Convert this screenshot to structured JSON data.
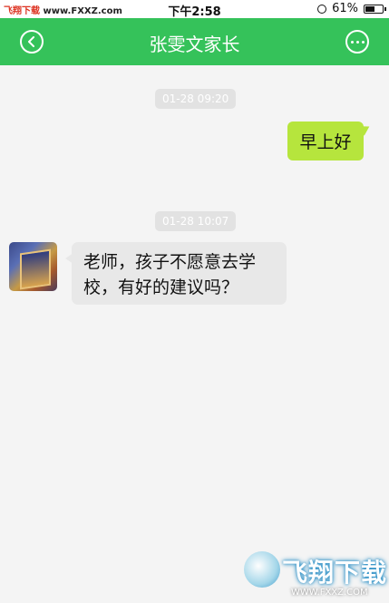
{
  "status_bar": {
    "watermark_prefix": "飞翔下载",
    "watermark_url": "www.FXXZ.com",
    "time": "下午2:58",
    "battery_percent": "61%",
    "battery_level": 0.61
  },
  "nav": {
    "title": "张雯文家长",
    "back_icon": "chevron-left-icon",
    "more_icon": "more-horizontal-icon",
    "accent_color": "#35c25a"
  },
  "messages": [
    {
      "timestamp": "01-28 09:20",
      "side": "right",
      "text": "早上好"
    },
    {
      "timestamp": "01-28 10:07",
      "side": "left",
      "text_line1": "老师，孩子不愿意去学",
      "text_line2": "校，有好的建议吗？"
    }
  ],
  "watermark": {
    "brand": "飞翔下载",
    "url": "WWW.FXXZ.COM"
  }
}
